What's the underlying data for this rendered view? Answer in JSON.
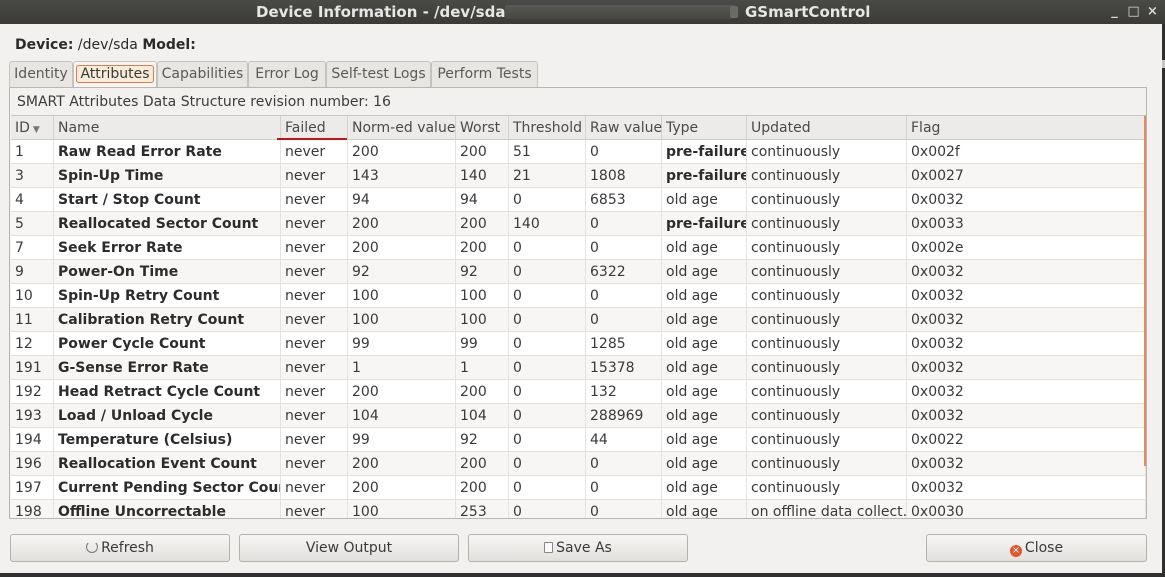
{
  "window": {
    "title_left": "Device Information - /dev/sda:",
    "title_right": "GSmartControl",
    "minimize": "_",
    "maximize": "□",
    "close": "×"
  },
  "device": {
    "device_label": "Device:",
    "device_value": "/dev/sda",
    "model_label": "Model:"
  },
  "tabs": [
    "Identity",
    "Attributes",
    "Capabilities",
    "Error Log",
    "Self-test Logs",
    "Perform Tests"
  ],
  "active_tab": "Attributes",
  "revision_text": "SMART Attributes Data Structure revision number: 16",
  "columns": [
    "ID",
    "Name",
    "Failed",
    "Norm-ed value",
    "Worst",
    "Threshold",
    "Raw value",
    "Type",
    "Updated",
    "Flag"
  ],
  "sort_indicator": "▼",
  "rows": [
    [
      "1",
      "Raw Read Error Rate",
      "never",
      "200",
      "200",
      "51",
      "0",
      "pre-failure",
      "continuously",
      "0x002f"
    ],
    [
      "3",
      "Spin-Up Time",
      "never",
      "143",
      "140",
      "21",
      "1808",
      "pre-failure",
      "continuously",
      "0x0027"
    ],
    [
      "4",
      "Start / Stop Count",
      "never",
      "94",
      "94",
      "0",
      "6853",
      "old age",
      "continuously",
      "0x0032"
    ],
    [
      "5",
      "Reallocated Sector Count",
      "never",
      "200",
      "200",
      "140",
      "0",
      "pre-failure",
      "continuously",
      "0x0033"
    ],
    [
      "7",
      "Seek Error Rate",
      "never",
      "200",
      "200",
      "0",
      "0",
      "old age",
      "continuously",
      "0x002e"
    ],
    [
      "9",
      "Power-On Time",
      "never",
      "92",
      "92",
      "0",
      "6322",
      "old age",
      "continuously",
      "0x0032"
    ],
    [
      "10",
      "Spin-Up Retry Count",
      "never",
      "100",
      "100",
      "0",
      "0",
      "old age",
      "continuously",
      "0x0032"
    ],
    [
      "11",
      "Calibration Retry Count",
      "never",
      "100",
      "100",
      "0",
      "0",
      "old age",
      "continuously",
      "0x0032"
    ],
    [
      "12",
      "Power Cycle Count",
      "never",
      "99",
      "99",
      "0",
      "1285",
      "old age",
      "continuously",
      "0x0032"
    ],
    [
      "191",
      "G-Sense Error Rate",
      "never",
      "1",
      "1",
      "0",
      "15378",
      "old age",
      "continuously",
      "0x0032"
    ],
    [
      "192",
      "Head Retract Cycle Count",
      "never",
      "200",
      "200",
      "0",
      "132",
      "old age",
      "continuously",
      "0x0032"
    ],
    [
      "193",
      "Load / Unload Cycle",
      "never",
      "104",
      "104",
      "0",
      "288969",
      "old age",
      "continuously",
      "0x0032"
    ],
    [
      "194",
      "Temperature (Celsius)",
      "never",
      "99",
      "92",
      "0",
      "44",
      "old age",
      "continuously",
      "0x0022"
    ],
    [
      "196",
      "Reallocation Event Count",
      "never",
      "200",
      "200",
      "0",
      "0",
      "old age",
      "continuously",
      "0x0032"
    ],
    [
      "197",
      "Current Pending Sector Count",
      "never",
      "200",
      "200",
      "0",
      "0",
      "old age",
      "continuously",
      "0x0032"
    ],
    [
      "198",
      "Offline Uncorrectable",
      "never",
      "100",
      "253",
      "0",
      "0",
      "old age",
      "on offline data collect.",
      "0x0030"
    ]
  ],
  "buttons": {
    "refresh": "Refresh",
    "view_output": "View Output",
    "save_as": "Save As",
    "close": "Close"
  },
  "icons": {
    "refresh": "refresh-icon",
    "save": "save-icon",
    "close": "close-icon"
  },
  "colors": {
    "accent": "#e07a4d",
    "failed_underline": "#c21616",
    "close_icon": "#e2552b"
  }
}
